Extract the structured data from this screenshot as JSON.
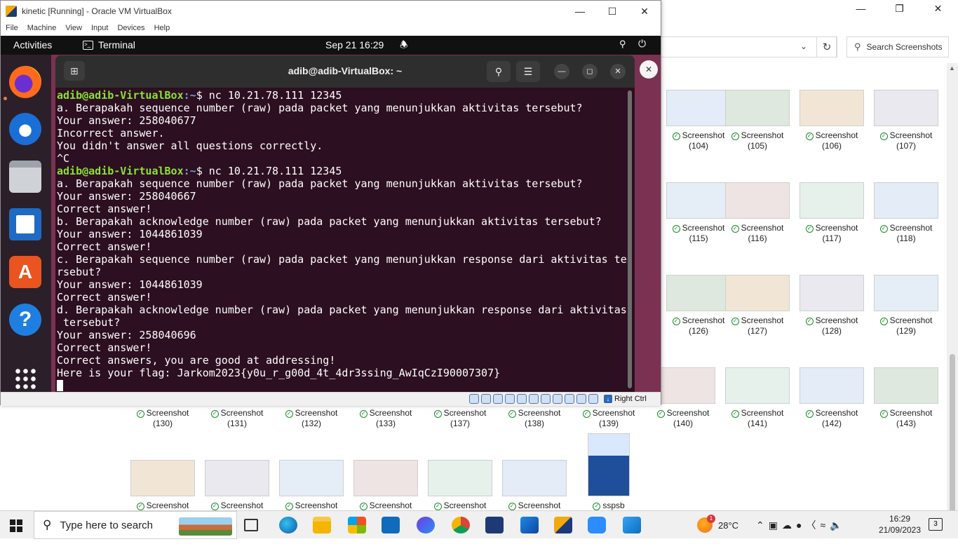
{
  "vbox": {
    "title": "kinetic [Running] - Oracle VM VirtualBox",
    "menu": [
      "File",
      "Machine",
      "View",
      "Input",
      "Devices",
      "Help"
    ],
    "host_key": "Right Ctrl"
  },
  "ubuntu": {
    "activities": "Activities",
    "app_name": "Terminal",
    "clock": "Sep 21  16:29"
  },
  "terminal": {
    "title": "adib@adib-VirtualBox: ~",
    "prompt_user": "adib@adib-VirtualBox",
    "prompt_path": ":~",
    "prompt_symbol": "$",
    "lines": [
      {
        "type": "prompt",
        "cmd": " nc 10.21.78.111 12345"
      },
      {
        "type": "out",
        "text": "a. Berapakah sequence number (raw) pada packet yang menunjukkan aktivitas tersebut?"
      },
      {
        "type": "out",
        "text": "Your answer: 258040677"
      },
      {
        "type": "out",
        "text": "Incorrect answer."
      },
      {
        "type": "out",
        "text": "You didn't answer all questions correctly."
      },
      {
        "type": "out",
        "text": "^C"
      },
      {
        "type": "prompt",
        "cmd": " nc 10.21.78.111 12345"
      },
      {
        "type": "out",
        "text": "a. Berapakah sequence number (raw) pada packet yang menunjukkan aktivitas tersebut?"
      },
      {
        "type": "out",
        "text": "Your answer: 258040667"
      },
      {
        "type": "out",
        "text": "Correct answer!"
      },
      {
        "type": "out",
        "text": "b. Berapakah acknowledge number (raw) pada packet yang menunjukkan aktivitas tersebut?"
      },
      {
        "type": "out",
        "text": "Your answer: 1044861039"
      },
      {
        "type": "out",
        "text": "Correct answer!"
      },
      {
        "type": "out",
        "text": "c. Berapakah sequence number (raw) pada packet yang menunjukkan response dari aktivitas te"
      },
      {
        "type": "out",
        "text": "rsebut?"
      },
      {
        "type": "out",
        "text": "Your answer: 1044861039"
      },
      {
        "type": "out",
        "text": "Correct answer!"
      },
      {
        "type": "out",
        "text": "d. Berapakah acknowledge number (raw) pada packet yang menunjukkan response dari aktivitas"
      },
      {
        "type": "out",
        "text": " tersebut?"
      },
      {
        "type": "out",
        "text": "Your answer: 258040696"
      },
      {
        "type": "out",
        "text": "Correct answer!"
      },
      {
        "type": "out",
        "text": "Correct answers, you are good at addressing!"
      },
      {
        "type": "out",
        "text": "Here is your flag: Jarkom2023{y0u_r_g00d_4t_4dr3ssing_AwIqCzI90007307}"
      }
    ]
  },
  "explorer": {
    "search_placeholder": "Search Screenshots",
    "items": [
      {
        "label": "Screenshot",
        "num": "(104)"
      },
      {
        "label": "Screenshot",
        "num": "(105)"
      },
      {
        "label": "Screenshot",
        "num": "(106)"
      },
      {
        "label": "Screenshot",
        "num": "(107)"
      },
      {
        "label": "Screenshot",
        "num": "(115)"
      },
      {
        "label": "Screenshot",
        "num": "(116)"
      },
      {
        "label": "Screenshot",
        "num": "(117)"
      },
      {
        "label": "Screenshot",
        "num": "(118)"
      },
      {
        "label": "Screenshot",
        "num": "(126)"
      },
      {
        "label": "Screenshot",
        "num": "(127)"
      },
      {
        "label": "Screenshot",
        "num": "(128)"
      },
      {
        "label": "Screenshot",
        "num": "(129)"
      },
      {
        "label": "Screenshot",
        "num": "(130)"
      },
      {
        "label": "Screenshot",
        "num": "(131)"
      },
      {
        "label": "Screenshot",
        "num": "(132)"
      },
      {
        "label": "Screenshot",
        "num": "(133)"
      },
      {
        "label": "Screenshot",
        "num": "(137)"
      },
      {
        "label": "Screenshot",
        "num": "(138)"
      },
      {
        "label": "Screenshot",
        "num": "(139)"
      },
      {
        "label": "Screenshot",
        "num": "(140)"
      },
      {
        "label": "Screenshot",
        "num": "(141)"
      },
      {
        "label": "Screenshot",
        "num": "(142)"
      },
      {
        "label": "Screenshot",
        "num": "(143)"
      },
      {
        "label": "Screenshot",
        "num": ""
      },
      {
        "label": "Screenshot",
        "num": ""
      },
      {
        "label": "Screenshot",
        "num": ""
      },
      {
        "label": "Screenshot",
        "num": ""
      },
      {
        "label": "Screenshot",
        "num": ""
      },
      {
        "label": "Screenshot",
        "num": ""
      },
      {
        "label": "sspsb",
        "num": ""
      }
    ]
  },
  "taskbar": {
    "search_placeholder": "Type here to search",
    "temperature": "28°C",
    "weather_badge": "1",
    "time": "16:29",
    "date": "21/09/2023",
    "notifications": "3"
  }
}
